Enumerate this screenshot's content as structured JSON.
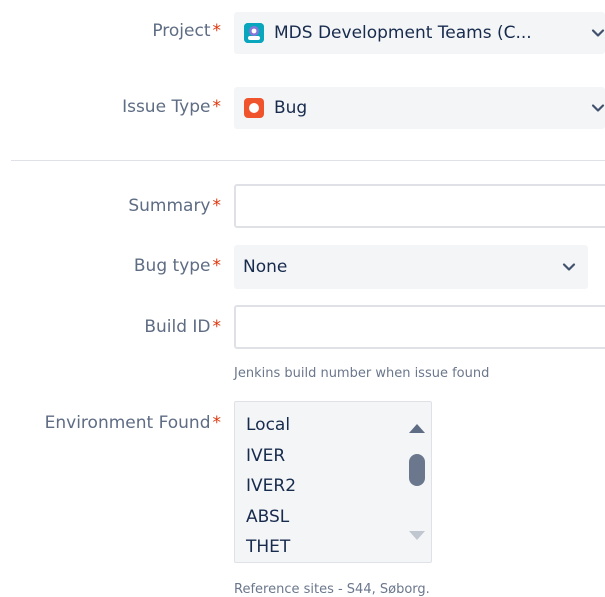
{
  "form": {
    "project": {
      "label": "Project",
      "required_mark": "*",
      "value": "MDS Development Teams (C...",
      "icon": "project-avatar-icon"
    },
    "issue_type": {
      "label": "Issue Type",
      "required_mark": "*",
      "value": "Bug",
      "icon": "bug-icon"
    },
    "summary": {
      "label": "Summary",
      "required_mark": "*",
      "value": ""
    },
    "bug_type": {
      "label": "Bug type",
      "required_mark": "*",
      "value": "None"
    },
    "build_id": {
      "label": "Build ID",
      "required_mark": "*",
      "value": "",
      "help": "Jenkins build number when issue found"
    },
    "environment_found": {
      "label": "Environment Found",
      "required_mark": "*",
      "options": [
        "Local",
        "IVER",
        "IVER2",
        "ABSL",
        "THET"
      ],
      "help": "Reference sites - S44, Søborg."
    }
  },
  "colors": {
    "required": "#de350b",
    "label": "#5e6c84",
    "field_bg": "#f4f5f7",
    "bug_icon": "#f0542d",
    "project_icon": "#0aa6bd"
  }
}
